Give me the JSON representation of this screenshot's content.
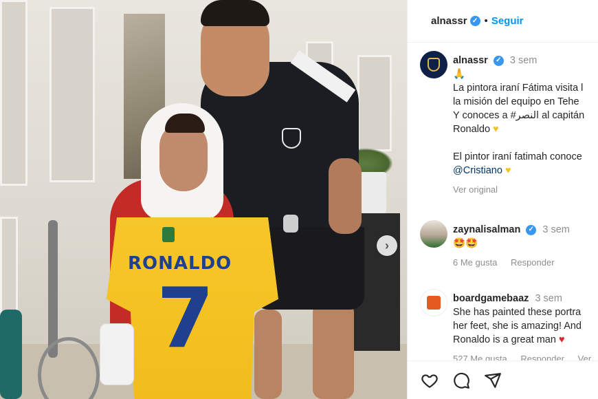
{
  "post": {
    "author": "alnassr",
    "follow_label": "Seguir",
    "jersey_name": "RONALDO",
    "jersey_number": "7"
  },
  "caption": {
    "username": "alnassr",
    "time": "3 sem",
    "emoji": "🙏",
    "lines": [
      "La pintora iraní Fátima visita l",
      "la misión del equipo en Tehe",
      "Y conoces a #النصر al capitán",
      "Ronaldo"
    ],
    "line2_2": "El pintor iraní fatimah conoce",
    "mention": "@Cristiano",
    "see_original": "Ver original"
  },
  "comments": [
    {
      "username": "zaynalisalman",
      "time": "3 sem",
      "text": "🤩🤩",
      "likes": "6 Me gusta",
      "reply": "Responder"
    },
    {
      "username": "boardgamebaaz",
      "time": "3 sem",
      "lines": [
        "She has painted these portra",
        "her feet, she is amazing! And",
        "Ronaldo is a great man"
      ],
      "likes": "527 Me gusta",
      "reply": "Responder",
      "more": "Ver"
    }
  ],
  "icons": {
    "like": "heart-icon",
    "comment": "comment-icon",
    "share": "share-icon",
    "next": "chevron-right-icon"
  },
  "colors": {
    "accent": "#0095f6",
    "verified": "#3897f0",
    "jersey": "#f6c72a",
    "jersey_text": "#1f3f8f"
  }
}
